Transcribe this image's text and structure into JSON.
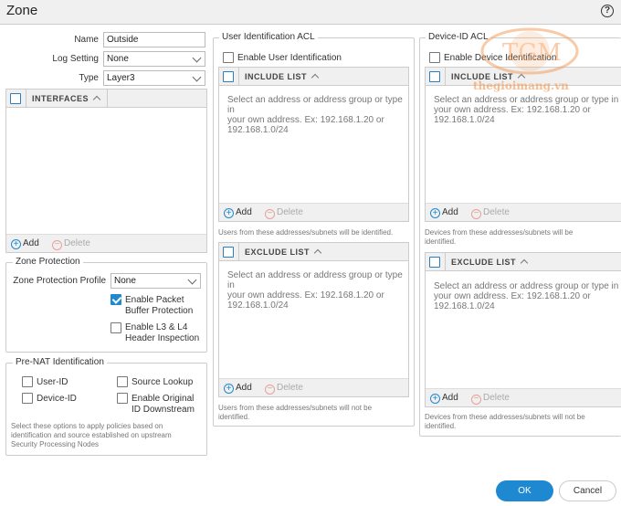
{
  "dialog": {
    "title": "Zone",
    "help_icon": "?"
  },
  "general": {
    "name_label": "Name",
    "name_value": "Outside",
    "log_label": "Log Setting",
    "log_value": "None",
    "type_label": "Type",
    "type_value": "Layer3"
  },
  "interfaces": {
    "header": "INTERFACES",
    "add": "Add",
    "delete": "Delete"
  },
  "zone_protection": {
    "legend": "Zone Protection",
    "profile_label": "Zone Protection Profile",
    "profile_value": "None",
    "packet_buffer_line1": "Enable Packet",
    "packet_buffer_line2": "Buffer Protection",
    "packet_buffer_checked": true,
    "l3l4_line1": "Enable L3 & L4",
    "l3l4_line2": "Header Inspection",
    "l3l4_checked": false
  },
  "prenat": {
    "legend": "Pre-NAT Identification",
    "user_id": "User-ID",
    "source_lookup": "Source Lookup",
    "device_id": "Device-ID",
    "enable_original_line1": "Enable Original",
    "enable_original_line2": "ID Downstream",
    "note_line1": "Select these options to apply policies based on",
    "note_line2": "identification and source established on upstream",
    "note_line3": "Security Processing Nodes"
  },
  "user_acl": {
    "legend": "User Identification ACL",
    "enable_label": "Enable User Identification",
    "include_header": "INCLUDE LIST",
    "exclude_header": "EXCLUDE LIST",
    "placeholder_line1": "Select an address or address group or type in",
    "placeholder_line2": "your own address. Ex: 192.168.1.20 or",
    "placeholder_line3": "192.168.1.0/24",
    "add": "Add",
    "delete": "Delete",
    "include_note": "Users from these addresses/subnets will be identified.",
    "exclude_note_line1": "Users from these addresses/subnets will not be",
    "exclude_note_line2": "identified."
  },
  "device_acl": {
    "legend": "Device-ID ACL",
    "enable_label": "Enable Device Identification",
    "include_header": "INCLUDE LIST",
    "exclude_header": "EXCLUDE LIST",
    "placeholder_line1": "Select an address or address group or type in",
    "placeholder_line2": "your own address. Ex: 192.168.1.20 or",
    "placeholder_line3": "192.168.1.0/24",
    "add": "Add",
    "delete": "Delete",
    "include_note_line1": "Devices from these addresses/subnets will be",
    "include_note_line2": "identified.",
    "exclude_note_line1": "Devices from these addresses/subnets will not be",
    "exclude_note_line2": "identified."
  },
  "buttons": {
    "ok": "OK",
    "cancel": "Cancel"
  },
  "watermark": {
    "text": "thegioimang.vn",
    "logo": "TGM"
  },
  "colors": {
    "accent": "#1e88d0",
    "watermark": "#f5a060"
  }
}
